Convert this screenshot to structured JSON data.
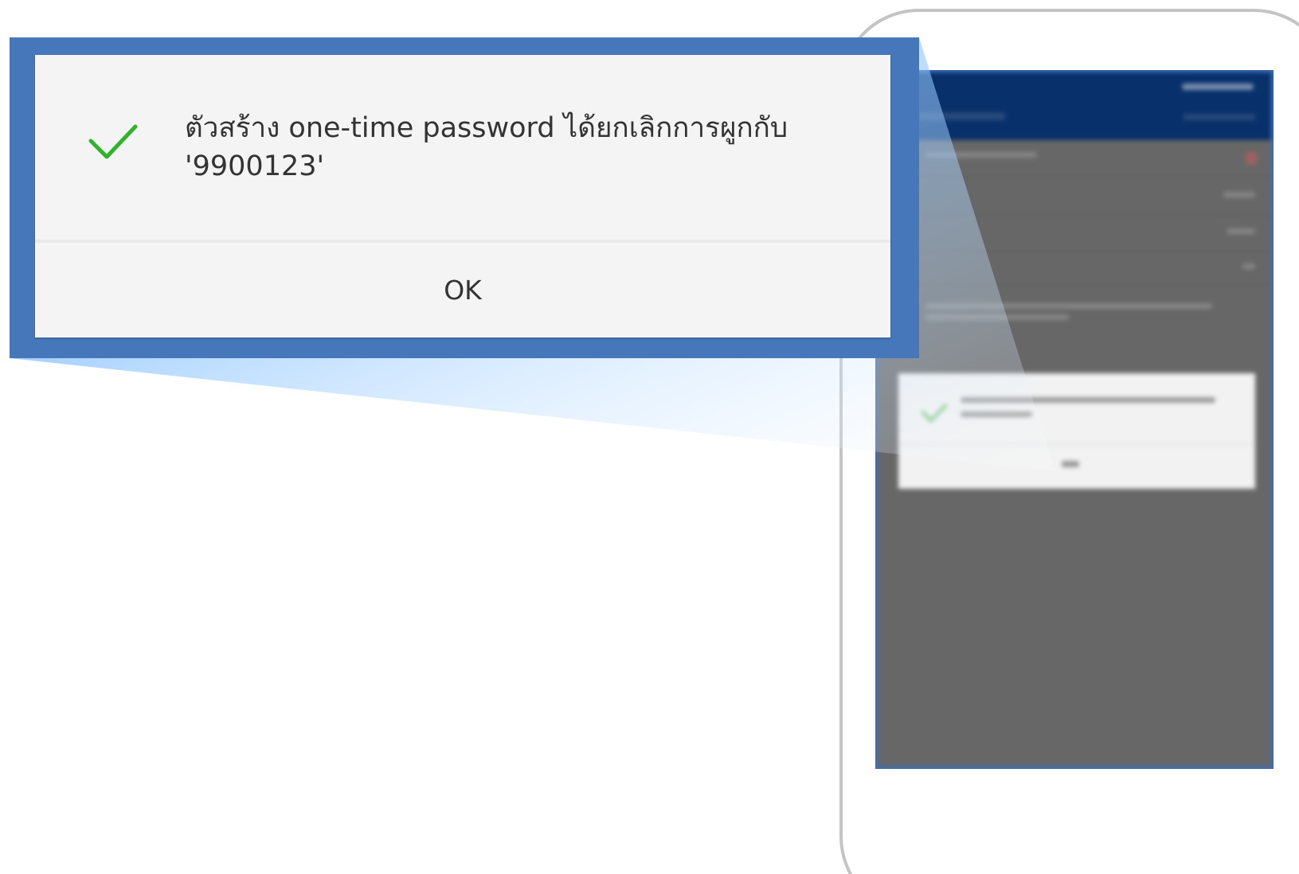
{
  "dialog": {
    "message": "ตัวสร้าง one-time password ได้ยกเลิกการผูกกับ '9900123'",
    "ok_label": "OK",
    "icon": "check-icon",
    "icon_color": "#2eb52a"
  },
  "colors": {
    "callout_frame": "#4577ba",
    "phone_outline": "#c4c4c4",
    "app_header": "#08306a",
    "overlay": "#676767"
  }
}
